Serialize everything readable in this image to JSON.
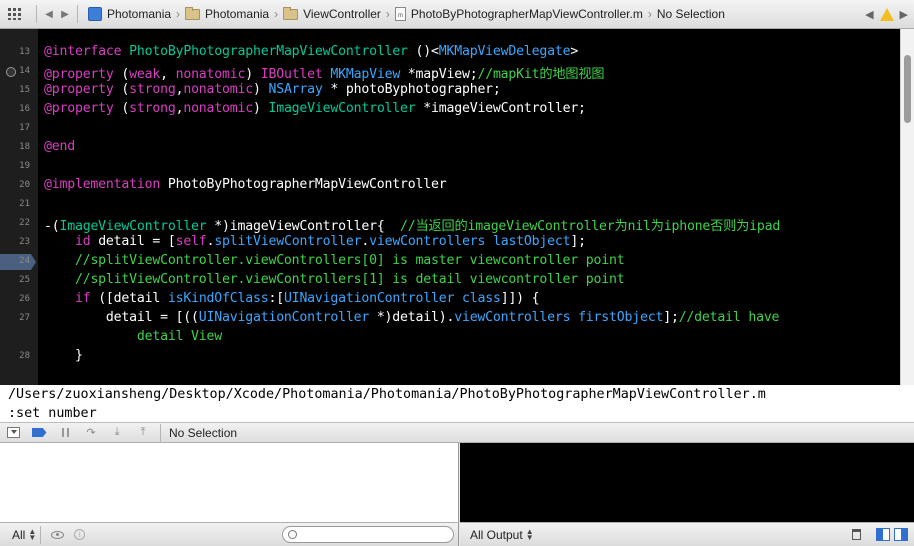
{
  "jumpbar": {
    "crumbs": [
      "Photomania",
      "Photomania",
      "ViewController",
      "PhotoByPhotographerMapViewController.m",
      "No Selection"
    ],
    "file_badge": "m"
  },
  "editor": {
    "lines": [
      {
        "num": "13",
        "html": "<span class=\"k\">@interface</span> <span class=\"t\">PhotoByPhotographerMapViewController</span> ()&lt;<span class=\"s\">MKMapViewDelegate</span>&gt;"
      },
      {
        "num": "14",
        "html": "<span class=\"k\">@property</span> (<span class=\"k\">weak</span>, <span class=\"k\">nonatomic</span>) <span class=\"k\">IBOutlet</span> <span class=\"s\">MKMapView</span> *mapView;<span class=\"c\">//mapKit的地图视图</span>"
      },
      {
        "num": "15",
        "html": "<span class=\"k\">@property</span> (<span class=\"k\">strong</span>,<span class=\"k\">nonatomic</span>) <span class=\"s\">NSArray</span> * photoByphotographer;"
      },
      {
        "num": "16",
        "html": "<span class=\"k\">@property</span> (<span class=\"k\">strong</span>,<span class=\"k\">nonatomic</span>) <span class=\"t\">ImageViewController</span> *imageViewController;"
      },
      {
        "num": "17",
        "html": ""
      },
      {
        "num": "18",
        "html": "<span class=\"k\">@end</span>"
      },
      {
        "num": "19",
        "html": ""
      },
      {
        "num": "20",
        "html": "<span class=\"k\">@implementation</span> PhotoByPhotographerMapViewController"
      },
      {
        "num": "21",
        "html": ""
      },
      {
        "num": "22",
        "html": "-(<span class=\"t\">ImageViewController</span> *)imageViewController{  <span class=\"c\">//当返回的imageViewController为nil为iphone否则为ipad</span>"
      },
      {
        "num": "23",
        "html": "    <span class=\"k\">id</span> detail = [<span class=\"k\">self</span>.<span class=\"s\">splitViewController</span>.<span class=\"s\">viewControllers</span> <span class=\"s\">lastObject</span>];"
      },
      {
        "num": "24",
        "html": "    <span class=\"c\">//splitViewController.viewControllers[0] is master viewcontroller point</span>"
      },
      {
        "num": "25",
        "html": "    <span class=\"c\">//splitViewController.viewControllers[1] is detail viewcontroller point</span>"
      },
      {
        "num": "26",
        "html": "    <span class=\"k\">if</span> ([detail <span class=\"s\">isKindOfClass</span>:[<span class=\"s\">UINavigationController</span> <span class=\"s\">class</span>]]) {"
      },
      {
        "num": "27",
        "html": "        detail = [((<span class=\"s\">UINavigationController</span> *)detail).<span class=\"s\">viewControllers</span> <span class=\"s\">firstObject</span>];<span class=\"c\">//detail have</span>"
      },
      {
        "num": "",
        "html": "            <span class=\"c\">detail View</span>"
      },
      {
        "num": "28",
        "html": "    }"
      }
    ]
  },
  "vim": {
    "path": "/Users/zuoxiansheng/Desktop/Xcode/Photomania/Photomania/PhotoByPhotographerMapViewController.m",
    "command": ":set number"
  },
  "debugbar": {
    "selection": "No Selection"
  },
  "bottom": {
    "scope_filter": "All",
    "output_filter": "All Output"
  }
}
